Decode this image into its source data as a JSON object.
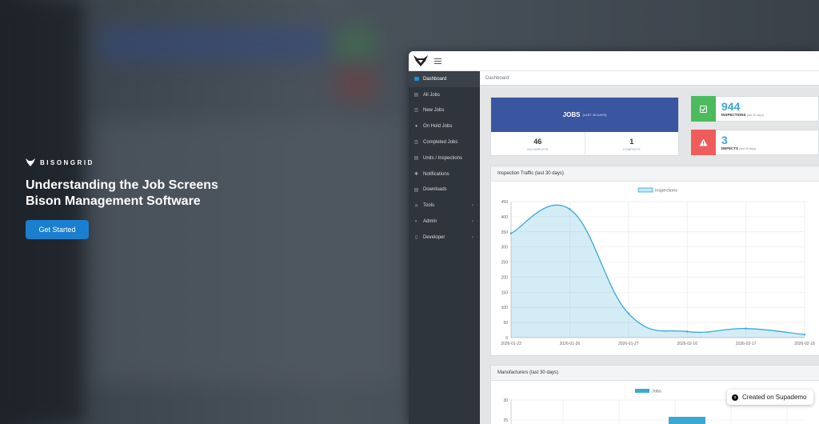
{
  "hero": {
    "brand": "BISONGRID",
    "title": "Understanding the Job Screens",
    "subtitle": "Bison Management Software",
    "cta_label": "Get Started"
  },
  "sidebar": {
    "items": [
      {
        "label": "Dashboard",
        "icon": "dashboard-icon"
      },
      {
        "label": "All Jobs",
        "icon": "document-icon"
      },
      {
        "label": "New Jobs",
        "icon": "list-icon"
      },
      {
        "label": "On Hold Jobs",
        "icon": "pause-circle-icon"
      },
      {
        "label": "Completed Jobs",
        "icon": "check-list-icon"
      },
      {
        "label": "Units / Inspections",
        "icon": "list-icon"
      },
      {
        "label": "Notifications",
        "icon": "bell-icon"
      },
      {
        "label": "Downloads",
        "icon": "download-icon"
      },
      {
        "label": "Tools",
        "icon": "tools-icon"
      },
      {
        "label": "Admin",
        "icon": "shield-icon"
      },
      {
        "label": "Developer",
        "icon": "code-icon"
      }
    ]
  },
  "breadcrumb": "Dashboard",
  "jobs_card": {
    "title": "JOBS",
    "subtitle": "(LAST 30 DAYS)",
    "incomplete_value": "46",
    "incomplete_label": "INCOMPLETE",
    "complete_value": "1",
    "complete_label": "COMPLETE"
  },
  "inspections_card": {
    "value": "944",
    "label": "INSPECTIONS",
    "period": "(last 30 days)",
    "color": "#4cbb5e"
  },
  "defects_card": {
    "value": "3",
    "label": "DEFECTS",
    "period": "(last 30 days)",
    "color": "#ef5c5c"
  },
  "traffic_panel": {
    "title": "Inspection Traffic (last 30 days)"
  },
  "manufacturers_panel": {
    "title": "Manufacturers (last 30 days)"
  },
  "chart_data": [
    {
      "type": "area",
      "title": "Inspection Traffic (last 30 days)",
      "x": [
        "2026-01-23",
        "2026-01-26",
        "2026-01-27",
        "2026-02-16",
        "2026-02-17",
        "2026-02-18"
      ],
      "series": [
        {
          "name": "Inspections",
          "values": [
            345,
            425,
            80,
            20,
            30,
            10
          ]
        }
      ],
      "yticks": [
        0,
        50,
        100,
        150,
        200,
        250,
        300,
        350,
        400,
        450
      ],
      "ylim": [
        0,
        450
      ],
      "grid": true,
      "legend": "top-center",
      "color": "#3aa8d4"
    },
    {
      "type": "bar",
      "title": "Manufacturers (last 30 days)",
      "series": [
        {
          "name": "Jobs"
        }
      ],
      "yticks": [
        25,
        30
      ],
      "legend": "top-center",
      "color": "#3aa8d4"
    }
  ],
  "badge": {
    "label": "Created on Supademo"
  }
}
